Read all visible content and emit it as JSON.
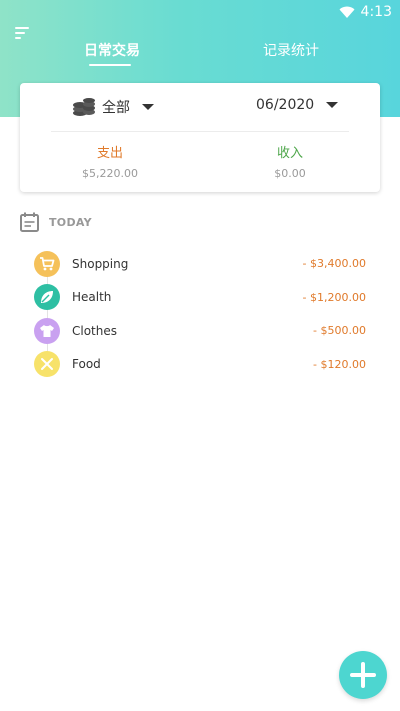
{
  "status_bar": {
    "time": "4:13"
  },
  "tabs": [
    {
      "label": "日常交易",
      "active": true
    },
    {
      "label": "记录统计",
      "active": false
    }
  ],
  "filter": {
    "account_label": "全部",
    "date_label": "06/2020"
  },
  "summary": {
    "expense": {
      "label": "支出",
      "amount": "$5,220.00"
    },
    "income": {
      "label": "收入",
      "amount": "$0.00"
    }
  },
  "section": {
    "label": "TODAY"
  },
  "transactions": [
    {
      "name": "Shopping",
      "amount": "- $3,400.00",
      "icon": "cart-icon",
      "color": "#f5c15a"
    },
    {
      "name": "Health",
      "amount": "- $1,200.00",
      "icon": "leaf-icon",
      "color": "#2ebfa3"
    },
    {
      "name": "Clothes",
      "amount": "- $500.00",
      "icon": "tshirt-icon",
      "color": "#c9a1f0"
    },
    {
      "name": "Food",
      "amount": "- $120.00",
      "icon": "utensils-icon",
      "color": "#f7e26a"
    }
  ],
  "colors": {
    "accent": "#4dd6d0",
    "expense": "#e07a2b",
    "income": "#4ea64a"
  }
}
